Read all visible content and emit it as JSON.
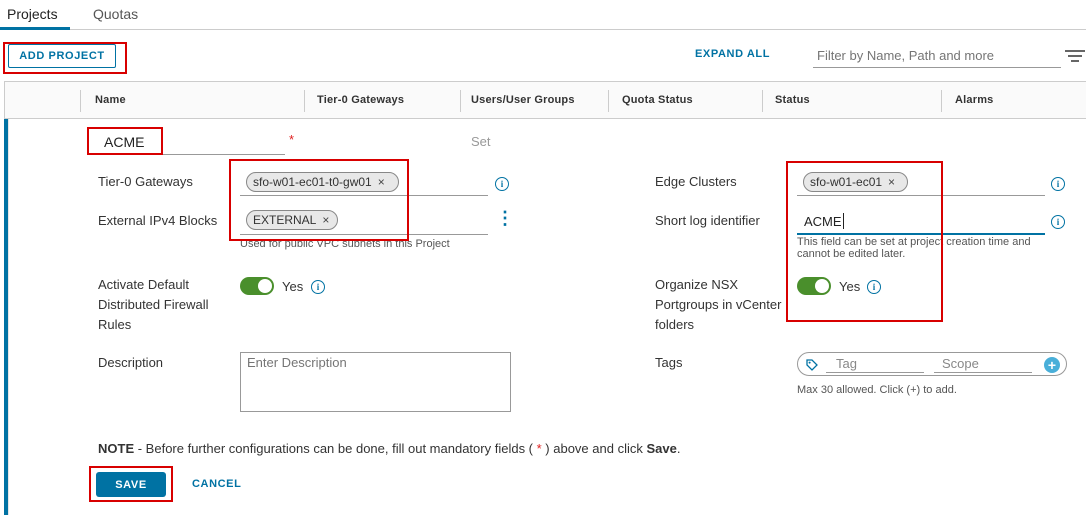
{
  "tabs": [
    {
      "label": "Projects",
      "active": true
    },
    {
      "label": "Quotas",
      "active": false
    }
  ],
  "toolbar": {
    "add_project_label": "ADD PROJECT",
    "expand_all_label": "EXPAND ALL",
    "filter_placeholder": "Filter by Name, Path and more"
  },
  "grid": {
    "columns": [
      "Name",
      "Tier-0 Gateways",
      "Users/User Groups",
      "Quota Status",
      "Status",
      "Alarms"
    ]
  },
  "form": {
    "name_value": "ACME",
    "required_marker": "*",
    "set_label": "Set",
    "tier0": {
      "label": "Tier-0 Gateways",
      "chip": "sfo-w01-ec01-t0-gw01",
      "chip_remove": "×"
    },
    "ipv4": {
      "label": "External IPv4 Blocks",
      "chip": "EXTERNAL",
      "chip_remove": "×",
      "hint": "Used for public VPC subnets in this Project",
      "more": "⋮"
    },
    "edge": {
      "label": "Edge Clusters",
      "chip": "sfo-w01-ec01",
      "chip_remove": "×"
    },
    "short_log": {
      "label": "Short log identifier",
      "value": "ACME",
      "hint_line1": "This field can be set at project creation time and",
      "hint_line2": "cannot be edited later."
    },
    "firewall": {
      "label_line1": "Activate Default",
      "label_line2": "Distributed Firewall",
      "label_line3": "Rules",
      "toggle_text": "Yes",
      "enabled": true
    },
    "portgroups": {
      "label_line1": "Organize NSX",
      "label_line2": "Portgroups in vCenter",
      "label_line3": "folders",
      "toggle_text": "Yes",
      "enabled": true
    },
    "description": {
      "label": "Description",
      "placeholder": "Enter Description"
    },
    "tags": {
      "label": "Tags",
      "tag_placeholder": "Tag",
      "scope_placeholder": "Scope",
      "hint": "Max 30 allowed. Click (+) to add.",
      "add_symbol": "+"
    },
    "note": {
      "prefix": "NOTE",
      "text": " - Before further configurations can be done, fill out mandatory fields ( ",
      "star": "*",
      "text2": " ) above and click ",
      "save_word": "Save",
      "end": "."
    },
    "save_label": "SAVE",
    "cancel_label": "CANCEL"
  },
  "colors": {
    "accent": "#0072a3",
    "highlight_red": "#d80000",
    "toggle_green": "#4a8f2c",
    "required_red": "#e02020"
  }
}
